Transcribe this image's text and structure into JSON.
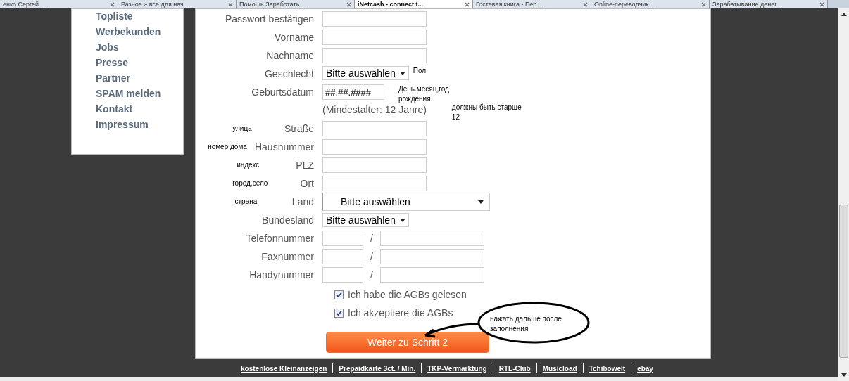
{
  "browser_tabs": [
    {
      "title": "енко Сергей ...",
      "selected": false
    },
    {
      "title": "Разное » все для нач...",
      "selected": false
    },
    {
      "title": "Помощь.Заработать ...",
      "selected": false
    },
    {
      "title": "iNetcash - connect t...",
      "selected": true
    },
    {
      "title": "Гостевая книга - Пер...",
      "selected": false
    },
    {
      "title": "Online-переводчик ...",
      "selected": false
    },
    {
      "title": "Зарабатывание денег...",
      "selected": false
    }
  ],
  "sidebar": {
    "items": [
      "Topliste",
      "Werbekunden",
      "Jobs",
      "Presse",
      "Partner",
      "SPAM melden",
      "Kontakt",
      "Impressum"
    ]
  },
  "form": {
    "rows": [
      {
        "kind": "text",
        "label": "Passwort bestätigen"
      },
      {
        "kind": "text",
        "label": "Vorname"
      },
      {
        "kind": "text",
        "label": "Nachname"
      },
      {
        "kind": "select",
        "label": "Geschlecht",
        "value": "Bitte auswählen",
        "note_right": "Пол"
      },
      {
        "kind": "date",
        "label": "Geburtsdatum",
        "value": "##.##.####",
        "note_right": "День.месяц,год рождения"
      },
      {
        "kind": "hint",
        "text": "(Mindestalter: 12 Janre)",
        "note_right": "должны быть старше 12"
      },
      {
        "kind": "text",
        "label": "Straße",
        "note_left": "улица"
      },
      {
        "kind": "text",
        "label": "Hausnummer",
        "note_left": "номер дома"
      },
      {
        "kind": "text",
        "label": "PLZ",
        "note_left": "индекс"
      },
      {
        "kind": "text",
        "label": "Ort",
        "note_left": "город,село"
      },
      {
        "kind": "wide_select",
        "label": "Land",
        "value": "Bitte auswählen",
        "note_left": "страна"
      },
      {
        "kind": "select",
        "label": "Bundesland",
        "value": "Bitte auswählen"
      },
      {
        "kind": "phone",
        "label": "Telefonnummer",
        "separator": "/"
      },
      {
        "kind": "phone",
        "label": "Faxnummer",
        "separator": "/"
      },
      {
        "kind": "phone",
        "label": "Handynummer",
        "separator": "/"
      }
    ],
    "checkboxes": [
      {
        "label": "Ich habe die AGBs gelesen",
        "checked": true
      },
      {
        "label": "Ich akzeptiere die AGBs",
        "checked": true
      }
    ],
    "submit_button": {
      "label": "Weiter zu Schritt 2"
    },
    "callout": {
      "text": "нажать дальше после заполнения"
    }
  },
  "footer_links": [
    "kostenlose Kleinanzeigen",
    "Prepaidkarte 3ct. / Min.",
    "TKP-Vermarktung",
    "RTL-Club",
    "Musicload",
    "Tchibowelt",
    "ebay"
  ]
}
